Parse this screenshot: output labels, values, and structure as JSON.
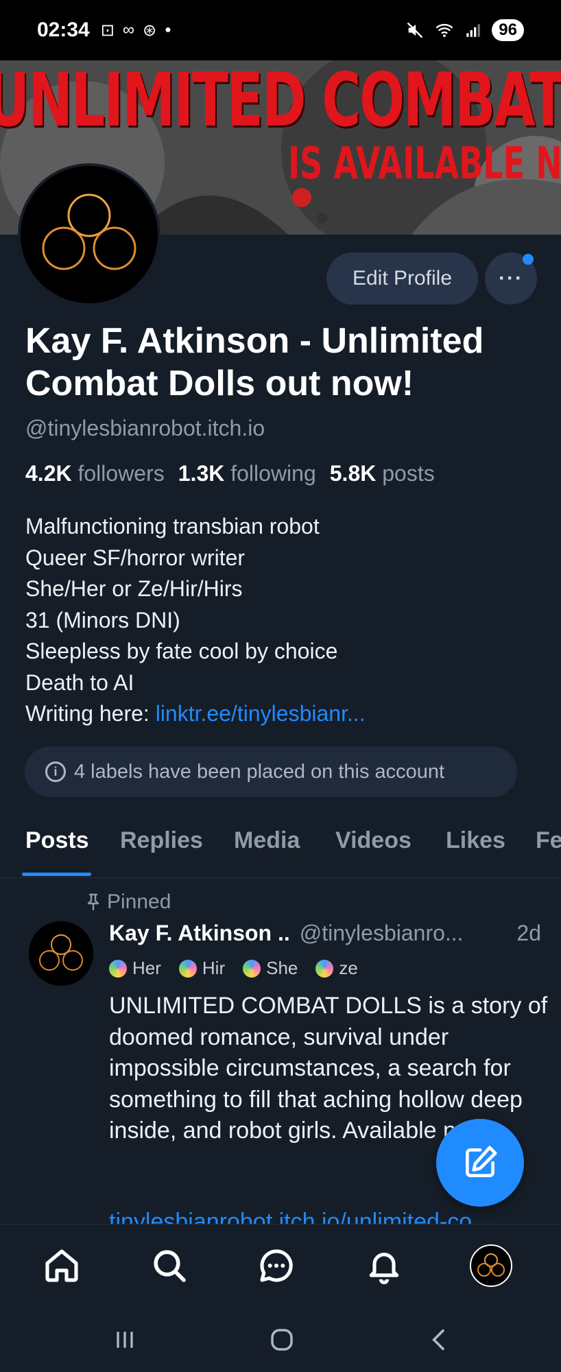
{
  "status_bar": {
    "time": "02:34",
    "battery": "96"
  },
  "banner": {
    "line1": "UNLIMITED COMBAT DOLLS",
    "line2": "IS AVAILABLE NOW"
  },
  "header": {
    "edit_profile_label": "Edit Profile",
    "more_label": "···"
  },
  "profile": {
    "display_name": "Kay F. Atkinson - Unlimited Combat Dolls out now!",
    "handle": "@tinylesbianrobot.itch.io",
    "followers_count": "4.2K",
    "followers_label": "followers",
    "following_count": "1.3K",
    "following_label": "following",
    "posts_count": "5.8K",
    "posts_label": "posts",
    "bio_lines": [
      "Malfunctioning transbian robot",
      "Queer SF/horror writer",
      "She/Her or Ze/Hir/Hirs",
      "31 (Minors DNI)",
      "Sleepless by fate cool by choice",
      "Death to AI"
    ],
    "bio_link_prefix": "Writing here: ",
    "bio_link": "linktr.ee/tinylesbianr...",
    "labels_notice": "4 labels have been placed on this account"
  },
  "tabs": [
    "Posts",
    "Replies",
    "Media",
    "Videos",
    "Likes",
    "Fe"
  ],
  "post": {
    "pinned_label": "Pinned",
    "author": "Kay F. Atkinson ..",
    "handle": "@tinylesbianro...",
    "time": "2d",
    "pronouns": [
      "Her",
      "Hir",
      "She",
      "ze"
    ],
    "text": "UNLIMITED COMBAT DOLLS is a story of doomed romance, survival under impossible circumstances, a search for something to fill that aching hollow deep inside, and robot girls. Available now.",
    "link": "tinylesbianrobot.itch.io/unlimited-co..."
  },
  "colors": {
    "accent": "#208bfe",
    "background": "#151d28",
    "banner_text": "#e0161c"
  }
}
